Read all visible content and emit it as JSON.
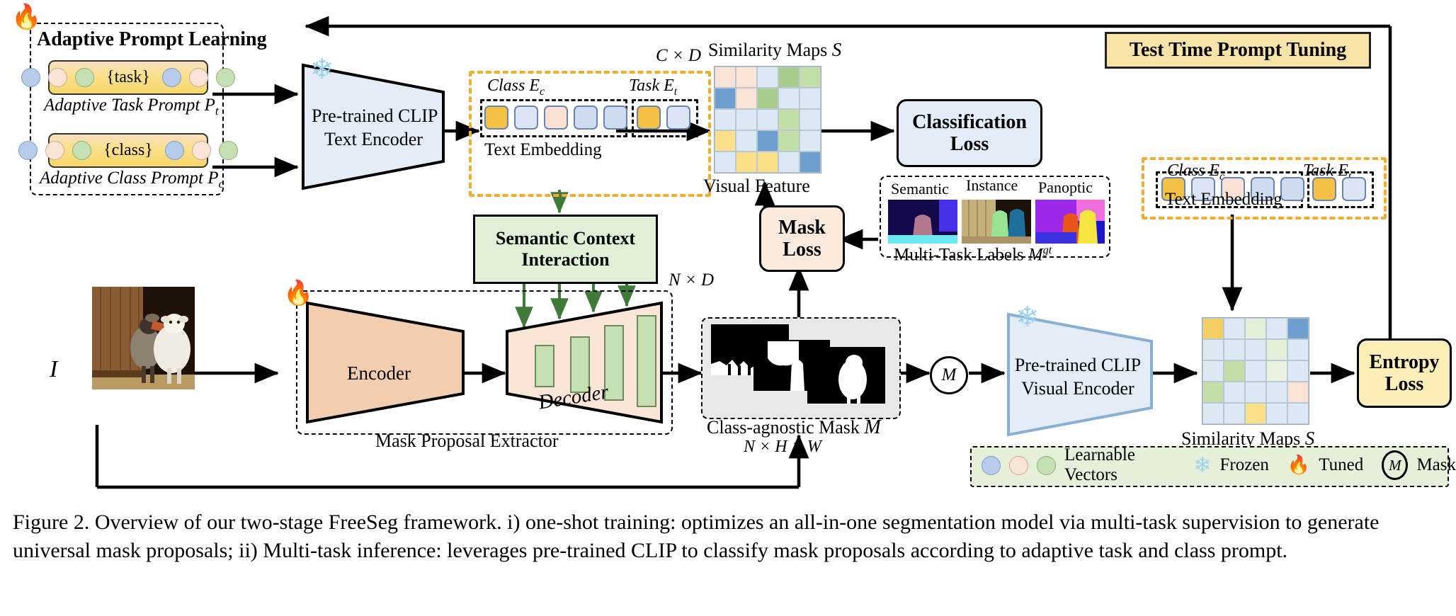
{
  "figure": {
    "caption": "Figure 2. Overview of our two-stage FreeSeg framework. i) one-shot training: optimizes an all-in-one segmentation model via multi-task supervision to generate universal mask proposals; ii) Multi-task inference: leverages pre-trained CLIP to classify mask proposals according to adaptive task and class prompt."
  },
  "adaptive_prompt": {
    "title": "Adaptive Prompt Learning",
    "task_prompt": {
      "slot": "{task}",
      "caption": "Adaptive Task Prompt P",
      "sub": "t"
    },
    "class_prompt": {
      "slot": "{class}",
      "caption": "Adaptive Class Prompt P",
      "sub": "c"
    }
  },
  "text_encoder": {
    "line1": "Pre-trained CLIP",
    "line2": "Text Encoder"
  },
  "visual_encoder": {
    "line1": "Pre-trained CLIP",
    "line2": "Visual Encoder"
  },
  "text_embedding_train": {
    "dim_label": "C × D",
    "class_label": "Class  E",
    "class_sub": "c",
    "task_label": "Task E",
    "task_sub": "t",
    "caption": "Text Embedding",
    "class_tokens": [
      "y",
      "b",
      "p",
      "lb",
      "lb"
    ],
    "task_tokens": [
      "y",
      "b"
    ]
  },
  "text_embedding_test": {
    "class_label": "Class  E",
    "class_sub": "c",
    "task_label": "Task E",
    "task_sub": "t",
    "caption": "Text Embedding",
    "class_tokens": [
      "y",
      "b",
      "p",
      "lb",
      "lb"
    ],
    "task_tokens": [
      "y",
      "b"
    ]
  },
  "similarity_train": {
    "title": "Similarity Maps S",
    "title_text": "Similarity Maps",
    "title_sym": "S",
    "footer": "Visual Feature"
  },
  "similarity_test": {
    "title_text": "Similarity Maps",
    "title_sym": "S"
  },
  "losses": {
    "classification": "Classification\nLoss",
    "classification_l1": "Classification",
    "classification_l2": "Loss",
    "mask_l1": "Mask",
    "mask_l2": "Loss",
    "entropy_l1": "Entropy",
    "entropy_l2": "Loss"
  },
  "semantic_context": {
    "l1": "Semantic Context",
    "l2": "Interaction"
  },
  "mask_proposal": {
    "encoder": "Encoder",
    "decoder": "Decoder",
    "caption": "Mask Proposal Extractor",
    "output_dim": "N × D"
  },
  "mask_output": {
    "caption": "Class-agnostic Mask",
    "symbol": "M",
    "shape": "N × H × W"
  },
  "multi_task_labels": {
    "columns": [
      "Semantic",
      "Instance",
      "Panoptic"
    ],
    "caption": "Multi-Task Labels",
    "symbol": "M",
    "symbol_sup": "gt"
  },
  "test_time": {
    "title": "Test Time Prompt Tuning"
  },
  "input": {
    "symbol": "I"
  },
  "mask_node": {
    "symbol": "M"
  },
  "legend": {
    "learnable": "Learnable Vectors",
    "frozen": "Frozen",
    "tuned": "Tuned",
    "mask": "Mask"
  },
  "chart_data": {
    "type": "heatmap",
    "title": "Similarity Maps S",
    "train_grid": [
      [
        "#fae3d6",
        "#fae3d6",
        "#dce9f5",
        "#a8cc8c",
        "#c3dfa6"
      ],
      [
        "#6d9ecd",
        "#fae3d6",
        "#a8cc8c",
        "#dce9f5",
        "#dce9f5"
      ],
      [
        "#dce9f5",
        "#dce9f5",
        "#dce9f5",
        "#c3dfa6",
        "#dce9f5"
      ],
      [
        "#fbe08a",
        "#dce9f5",
        "#6d9ecd",
        "#c3dfa6",
        "#dce9f5"
      ],
      [
        "#dce9f5",
        "#fbe08a",
        "#fbe08a",
        "#dce9f5",
        "#6d9ecd"
      ]
    ],
    "test_grid": [
      [
        "#f5cf62",
        "#dce9f5",
        "#e3efd8",
        "#dce9f5",
        "#6d9ecd"
      ],
      [
        "#dce9f5",
        "#dce9f5",
        "#dce9f5",
        "#e3efd8",
        "#dce9f5"
      ],
      [
        "#dce9f5",
        "#c3dfa6",
        "#dce9f5",
        "#e9f2de",
        "#dce9f5"
      ],
      [
        "#c3dfa6",
        "#dce9f5",
        "#dce9f5",
        "#dce9f5",
        "#fae3d6"
      ],
      [
        "#dce9f5",
        "#dce9f5",
        "#fbe08a",
        "#dce9f5",
        "#dce9f5"
      ]
    ]
  },
  "colors": {
    "prompt_yellow": "#f6d76b",
    "orange_dash": "#f0ad30",
    "green_panel": "#e1efd6",
    "encoder_peach": "#f3cdb0",
    "decoder_peach": "#fbe5d6",
    "loss_blue": "#e4ecf8",
    "loss_pink": "#fbeade",
    "loss_yellow": "#fdeeb8",
    "title_yellow": "#f8e3a8"
  }
}
